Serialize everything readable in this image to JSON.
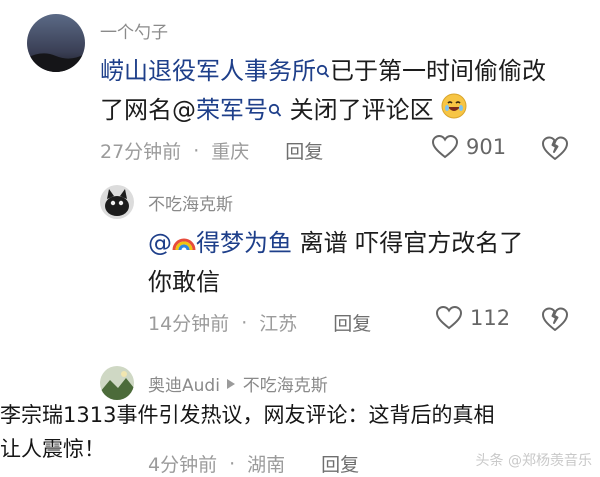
{
  "comment1": {
    "author": "一个勺子",
    "mention_prefix": "崂山退役军人事务所",
    "line1_rest": "已于第一时间偷偷改",
    "line2_start": "了网名@",
    "mention2": "荣军号",
    "line2_end": "关闭了评论区",
    "emoji": "laugh-emoji",
    "time": "27分钟前",
    "location": "重庆",
    "reply_label": "回复",
    "likes": "901"
  },
  "comment2": {
    "author": "不吃海克斯",
    "mention_at": "@",
    "mention_name": "得梦为鱼",
    "text_line1": "离谱  吓得官方改名了",
    "text_line2": "你敢信",
    "time": "14分钟前",
    "location": "江苏",
    "reply_label": "回复",
    "likes": "112"
  },
  "comment3": {
    "author": "奥迪Audi",
    "reply_to": "不吃海克斯",
    "time": "4分钟前",
    "location": "湖南",
    "reply_label": "回复"
  },
  "caption": {
    "line1": "李宗瑞1313事件引发热议，网友评论：这背后的真相",
    "line2": "让人震惊！"
  },
  "watermark": "头条 @郑杨羡音乐",
  "colors": {
    "link": "#1e3f8a",
    "meta": "#9b9b9b",
    "author": "#8a8a8a"
  }
}
